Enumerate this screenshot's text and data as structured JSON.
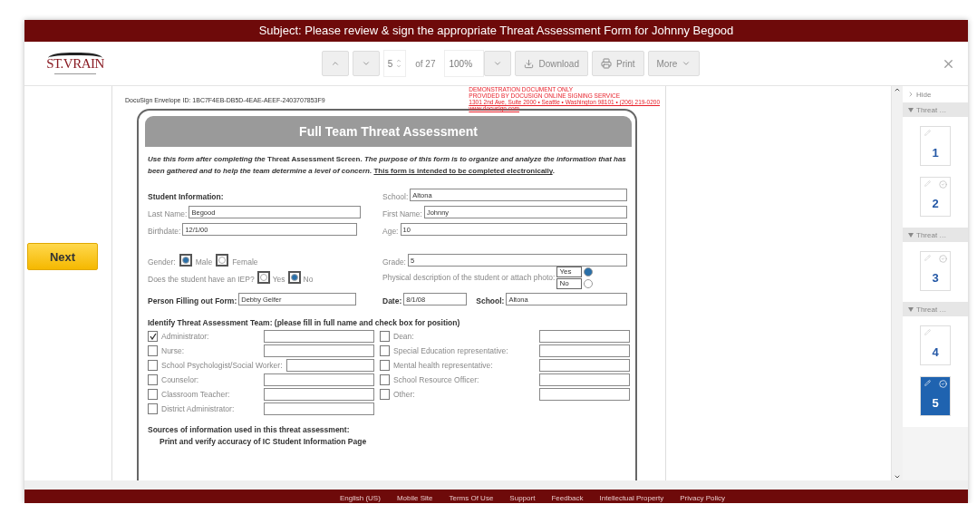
{
  "subject": "Subject: Please review & sign the appropriate Threat Assessment Form for Johnny Begood",
  "logo": {
    "name": "ST.VRAIN"
  },
  "toolbar": {
    "page": "5",
    "of": "of 27",
    "zoom": "100%",
    "buttons": [
      {
        "kind": "download",
        "label": "Download"
      },
      {
        "kind": "print",
        "label": "Print"
      },
      {
        "kind": "more",
        "label": "More"
      }
    ]
  },
  "next_button": "Next",
  "document": {
    "envelope_id": "DocuSign Envelope ID: 1BC7F4EB-DB5D-4EAE-AEEF-2403707853F9",
    "demo_notice": [
      "DEMONSTRATION DOCUMENT ONLY",
      "PROVIDED BY DOCUSIGN ONLINE SIGNING SERVICE",
      "1301 2nd Ave, Suite 2000  • Seattle • Washington 98101 • (206) 219-0200",
      "www.docusign.com"
    ],
    "form_title": "Full Team Threat Assessment",
    "intro": [
      {
        "kind": "italic",
        "text": "Use this form after completing the "
      },
      {
        "kind": "plain",
        "text": "Threat Assessment Screen."
      },
      {
        "kind": "italic",
        "text": " The purpose of this form is to organize and analyze the information that has been gathered and to help the team determine a level of concern. "
      },
      {
        "kind": "underline",
        "text": "This form is intended to be completed electronically"
      },
      {
        "kind": "plain",
        "text": "."
      }
    ],
    "student": {
      "heading": "Student Information:",
      "school": {
        "label": "School:",
        "value": "Altona"
      },
      "last_name": {
        "label": "Last Name:",
        "value": "Begood"
      },
      "first_name": {
        "label": "First Name:",
        "value": "Johnny"
      },
      "birthdate": {
        "label": "Birthdate:",
        "value": "12/1/00"
      },
      "age": {
        "label": "Age:",
        "value": "10"
      },
      "gender": {
        "label": "Gender:",
        "options": [
          {
            "label": "Male",
            "selected": true
          },
          {
            "label": "Female",
            "selected": false
          }
        ]
      },
      "grade": {
        "label": "Grade:",
        "value": "5"
      },
      "iep": {
        "label": "Does the student have an IEP?",
        "options": [
          {
            "label": "Yes",
            "selected": false
          },
          {
            "label": "No",
            "selected": true
          }
        ]
      },
      "photo": {
        "label": "Physical description of the student or attach photo:",
        "options": [
          {
            "label": "Yes",
            "selected": true
          },
          {
            "label": "No",
            "selected": false
          }
        ]
      },
      "person": {
        "label": "Person Filling out Form:",
        "value": "Debby Gelfer"
      },
      "date": {
        "label": "Date:",
        "value": "8/1/08"
      },
      "school2": {
        "label": "School:",
        "value": "Altona"
      }
    },
    "team": {
      "heading": "Identify Threat Assessment Team: (please fill in full name and check box for position)",
      "left": [
        {
          "label": "Administrator:",
          "checked": true
        },
        {
          "label": "Nurse:",
          "checked": false
        },
        {
          "label": "School Psychologist/Social Worker:",
          "checked": false
        },
        {
          "label": "Counselor:",
          "checked": false
        },
        {
          "label": "Classroom Teacher:",
          "checked": false
        },
        {
          "label": "District Administrator:",
          "checked": false
        }
      ],
      "right": [
        {
          "label": "Dean:",
          "checked": false
        },
        {
          "label": "Special Education representative:",
          "checked": false
        },
        {
          "label": "Mental health representative:",
          "checked": false
        },
        {
          "label": "School Resource Officer:",
          "checked": false
        },
        {
          "label": "Other:",
          "checked": false
        }
      ]
    },
    "sources": {
      "heading": "Sources of information used in this threat assessment:",
      "first_item": "Print and verify accuracy of IC Student Information Page"
    }
  },
  "thumbnails": {
    "hide": "Hide",
    "groups": [
      {
        "label": "Threat …",
        "pages": [
          {
            "number": "1",
            "signed": false,
            "selected": false
          },
          {
            "number": "2",
            "signed": true,
            "selected": false
          }
        ]
      },
      {
        "label": "Threat …",
        "pages": [
          {
            "number": "3",
            "signed": true,
            "selected": false
          }
        ]
      },
      {
        "label": "Threat …",
        "pages": [
          {
            "number": "4",
            "signed": false,
            "selected": false
          },
          {
            "number": "5",
            "signed": true,
            "selected": true
          }
        ]
      }
    ]
  },
  "footer_links": [
    "English (US)",
    "Mobile Site",
    "Terms Of Use",
    "Support",
    "Feedback",
    "Intellectual Property",
    "Privacy Policy"
  ]
}
